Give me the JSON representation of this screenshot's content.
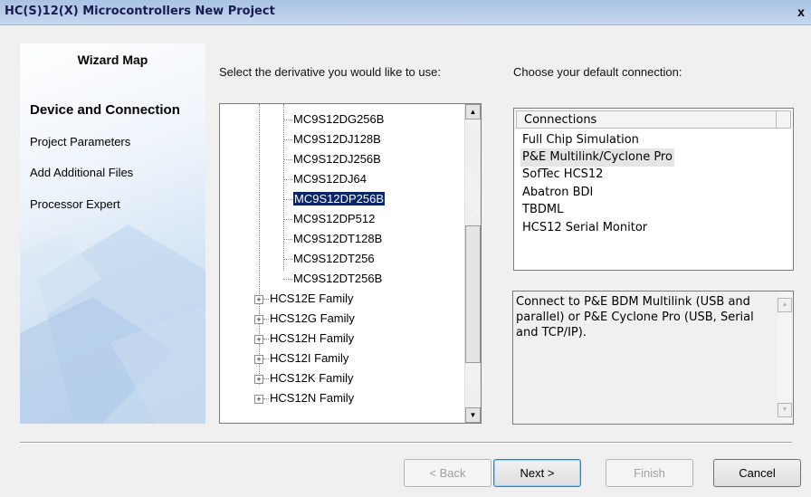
{
  "window": {
    "title": "HC(S)12(X) Microcontrollers New Project",
    "close_glyph": "x"
  },
  "wizard_map": {
    "title": "Wizard Map",
    "steps": [
      {
        "label": "Device and Connection",
        "current": true
      },
      {
        "label": "Project Parameters",
        "current": false
      },
      {
        "label": "Add Additional Files",
        "current": false
      },
      {
        "label": "Processor Expert",
        "current": false
      }
    ]
  },
  "derivative": {
    "prompt": "Select the derivative you would like to use:",
    "items": [
      "MC9S12DG256B",
      "MC9S12DJ128B",
      "MC9S12DJ256B",
      "MC9S12DJ64",
      "MC9S12DP256B",
      "MC9S12DP512",
      "MC9S12DT128B",
      "MC9S12DT256",
      "MC9S12DT256B"
    ],
    "selected": "MC9S12DP256B",
    "families": [
      "HCS12E Family",
      "HCS12G Family",
      "HCS12H Family",
      "HCS12I Family",
      "HCS12K Family",
      "HCS12N Family"
    ]
  },
  "connection": {
    "prompt": "Choose your default connection:",
    "column_header": "Connections",
    "items": [
      "Full Chip Simulation",
      "P&E Multilink/Cyclone Pro",
      "SofTec HCS12",
      "Abatron BDI",
      "TBDML",
      "HCS12 Serial Monitor"
    ],
    "selected": "P&E Multilink/Cyclone Pro",
    "description": "Connect to P&E BDM Multilink (USB and parallel) or P&E Cyclone Pro (USB, Serial and TCP/IP)."
  },
  "buttons": {
    "back": "< Back",
    "next": "Next >",
    "finish": "Finish",
    "cancel": "Cancel"
  }
}
